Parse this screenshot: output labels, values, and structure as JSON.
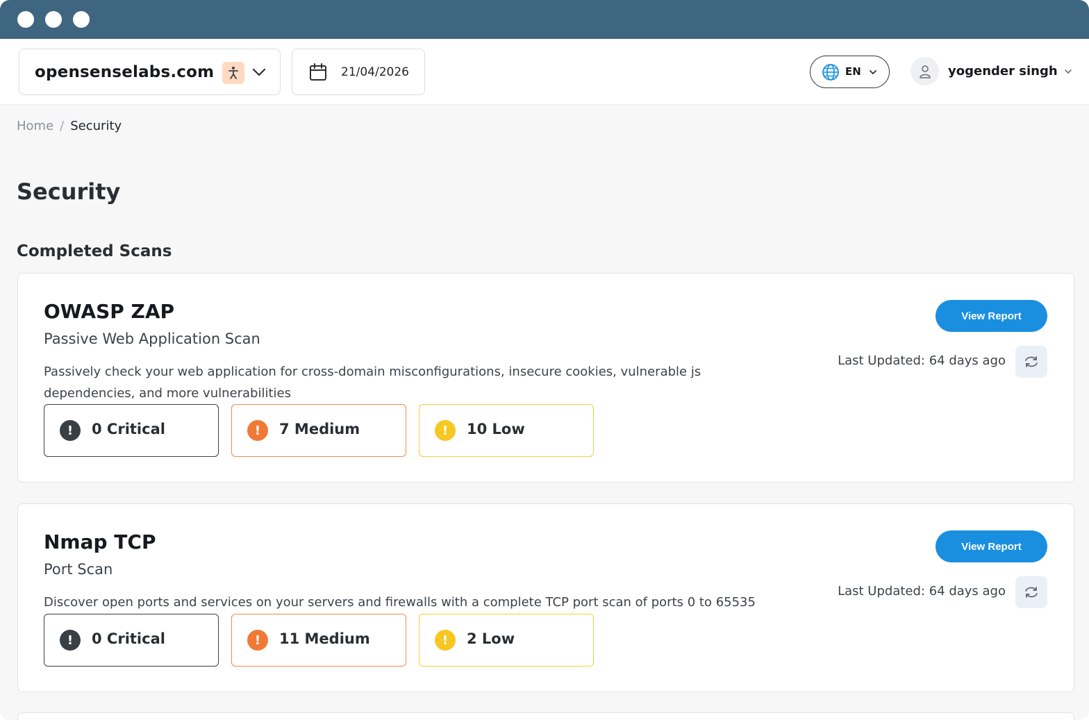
{
  "header": {
    "site": {
      "name": "opensenselabs.com",
      "badge_icon": "accessibility-icon"
    },
    "date": "21/04/2026",
    "language": "EN",
    "user_name": "yogender singh"
  },
  "breadcrumb": {
    "home": "Home",
    "separator": "/",
    "current": "Security"
  },
  "page_title": "Security",
  "section_title": "Completed Scans",
  "colors": {
    "titlebar": "#3f6680",
    "accent": "#1a8fe0",
    "critical": "#3a3f45",
    "medium": "#f08a4b",
    "low": "#f5cf3a"
  },
  "scans": [
    {
      "title": "OWASP ZAP",
      "subtitle": "Passive Web Application Scan",
      "description": "Passively check your web application for cross-domain misconfigurations, insecure cookies, vulnerable js dependencies, and more vulnerabilities",
      "view_label": "View Report",
      "last_updated": "Last Updated: 64 days ago",
      "critical": "0 Critical",
      "medium": "7 Medium",
      "low": "10 Low"
    },
    {
      "title": "Nmap TCP",
      "subtitle": "Port Scan",
      "description": "Discover open ports and services on your servers and firewalls with a complete TCP port scan of ports 0 to 65535",
      "view_label": "View Report",
      "last_updated": "Last Updated: 64 days ago",
      "critical": "0 Critical",
      "medium": "11 Medium",
      "low": "2 Low"
    }
  ]
}
